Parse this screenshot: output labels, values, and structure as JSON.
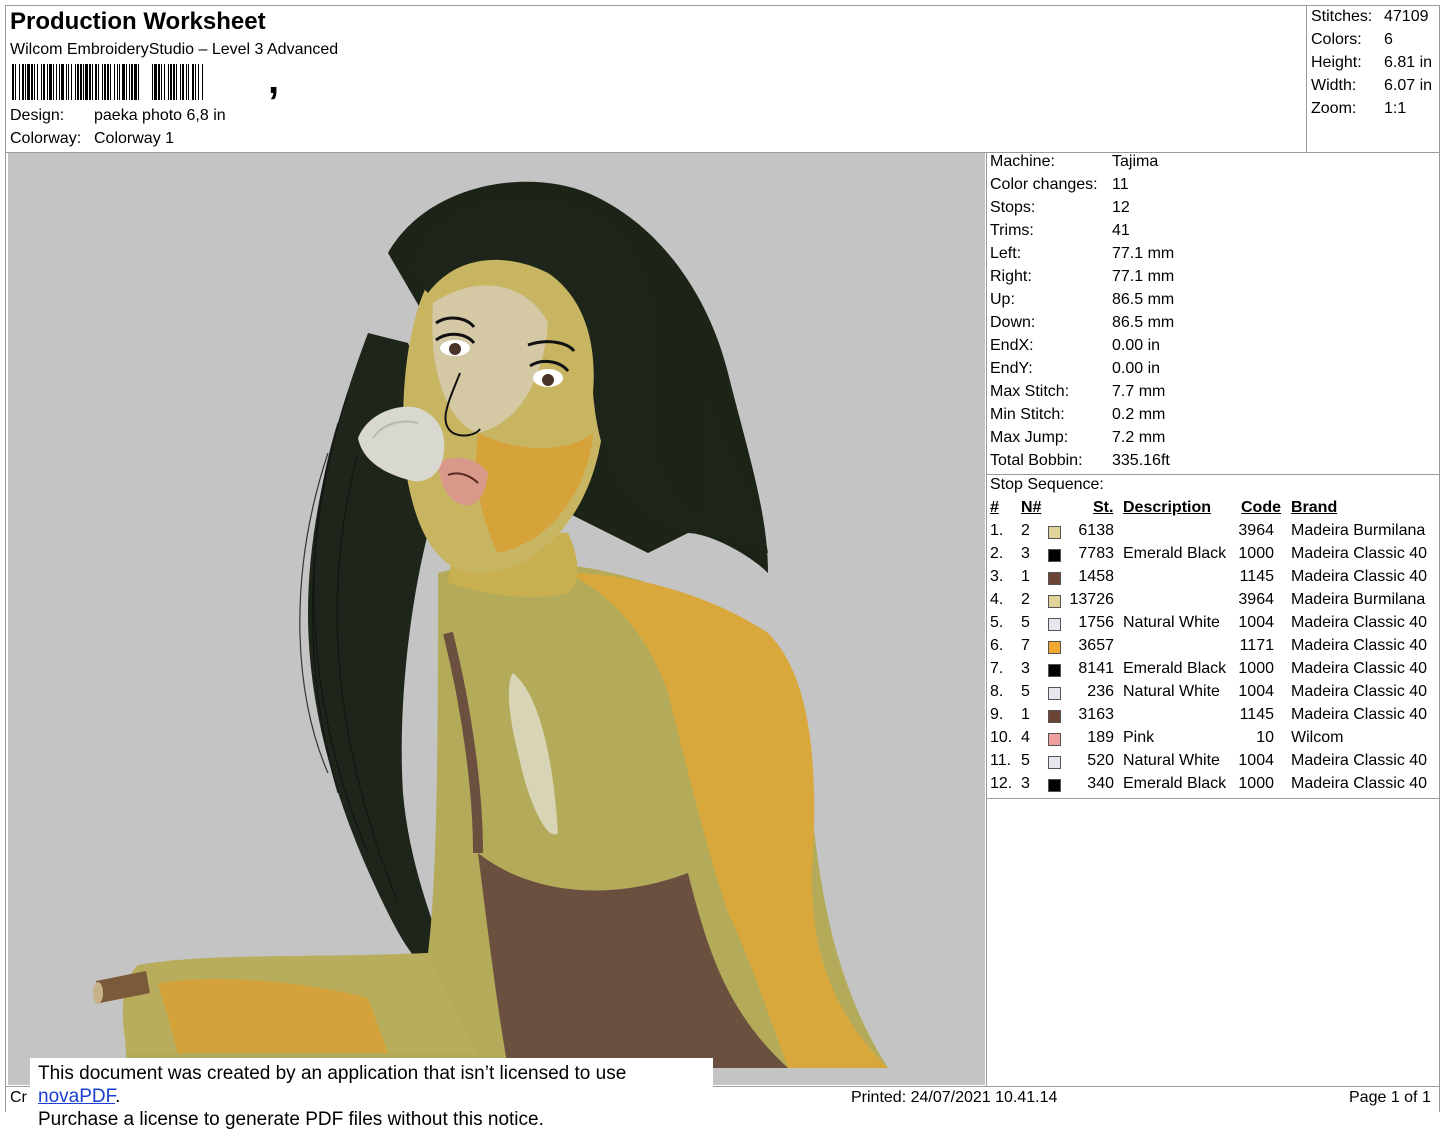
{
  "header": {
    "title": "Production Worksheet",
    "software": "Wilcom EmbroideryStudio – Level 3 Advanced",
    "design_label": "Design:",
    "design_value": "paeka photo 6,8 in",
    "colorway_label": "Colorway:",
    "colorway_value": "Colorway 1"
  },
  "summary": [
    {
      "label": "Stitches:",
      "value": "47109"
    },
    {
      "label": "Colors:",
      "value": "6"
    },
    {
      "label": "Height:",
      "value": "6.81 in"
    },
    {
      "label": "Width:",
      "value": "6.07 in"
    },
    {
      "label": "Zoom:",
      "value": "1:1"
    }
  ],
  "machine_info": [
    {
      "label": "Machine:",
      "value": "Tajima"
    },
    {
      "label": "Color changes:",
      "value": "11"
    },
    {
      "label": "Stops:",
      "value": "12"
    },
    {
      "label": "Trims:",
      "value": "41"
    },
    {
      "label": "Left:",
      "value": "77.1 mm"
    },
    {
      "label": "Right:",
      "value": "77.1 mm"
    },
    {
      "label": "Up:",
      "value": "86.5 mm"
    },
    {
      "label": "Down:",
      "value": "86.5 mm"
    },
    {
      "label": "EndX:",
      "value": "0.00 in"
    },
    {
      "label": "EndY:",
      "value": "0.00 in"
    },
    {
      "label": "Max Stitch:",
      "value": "7.7 mm"
    },
    {
      "label": "Min Stitch:",
      "value": "0.2 mm"
    },
    {
      "label": "Max Jump:",
      "value": "7.2 mm"
    },
    {
      "label": "Total Bobbin:",
      "value": "335.16ft"
    }
  ],
  "stop_sequence": {
    "title": "Stop Sequence:",
    "headers": {
      "num": "#",
      "n": "N#",
      "st": "St.",
      "description": "Description",
      "code": "Code",
      "brand": "Brand"
    },
    "rows": [
      {
        "num": "1.",
        "n": "2",
        "color": "#e0d49a",
        "st": "6138",
        "description": "",
        "code": "3964",
        "brand": "Madeira Burmilana"
      },
      {
        "num": "2.",
        "n": "3",
        "color": "#000000",
        "st": "7783",
        "description": "Emerald Black",
        "code": "1000",
        "brand": "Madeira Classic 40"
      },
      {
        "num": "3.",
        "n": "1",
        "color": "#6b4436",
        "st": "1458",
        "description": "",
        "code": "1145",
        "brand": "Madeira Classic 40"
      },
      {
        "num": "4.",
        "n": "2",
        "color": "#e0d49a",
        "st": "13726",
        "description": "",
        "code": "3964",
        "brand": "Madeira Burmilana"
      },
      {
        "num": "5.",
        "n": "5",
        "color": "#e6e6ee",
        "st": "1756",
        "description": "Natural White",
        "code": "1004",
        "brand": "Madeira Classic 40"
      },
      {
        "num": "6.",
        "n": "7",
        "color": "#f0a830",
        "st": "3657",
        "description": "",
        "code": "1171",
        "brand": "Madeira Classic 40"
      },
      {
        "num": "7.",
        "n": "3",
        "color": "#000000",
        "st": "8141",
        "description": "Emerald Black",
        "code": "1000",
        "brand": "Madeira Classic 40"
      },
      {
        "num": "8.",
        "n": "5",
        "color": "#e6e6ee",
        "st": "236",
        "description": "Natural White",
        "code": "1004",
        "brand": "Madeira Classic 40"
      },
      {
        "num": "9.",
        "n": "1",
        "color": "#6b4436",
        "st": "3163",
        "description": "",
        "code": "1145",
        "brand": "Madeira Classic 40"
      },
      {
        "num": "10.",
        "n": "4",
        "color": "#f0a0a0",
        "st": "189",
        "description": "Pink",
        "code": "10",
        "brand": "Wilcom"
      },
      {
        "num": "11.",
        "n": "5",
        "color": "#e6e6ee",
        "st": "520",
        "description": "Natural White",
        "code": "1004",
        "brand": "Madeira Classic 40"
      },
      {
        "num": "12.",
        "n": "3",
        "color": "#000000",
        "st": "340",
        "description": "Emerald Black",
        "code": "1000",
        "brand": "Madeira Classic 40"
      }
    ]
  },
  "notice": {
    "line1_prefix": "This document was created by an application that isn’t licensed to use ",
    "link": "novaPDF",
    "line1_suffix": ".",
    "line2": "Purchase a license to generate PDF files without this notice."
  },
  "footer": {
    "left_fragment": "Cr",
    "printed": "Printed: 24/07/2021 10.41.14",
    "page": "Page 1 of 1"
  }
}
